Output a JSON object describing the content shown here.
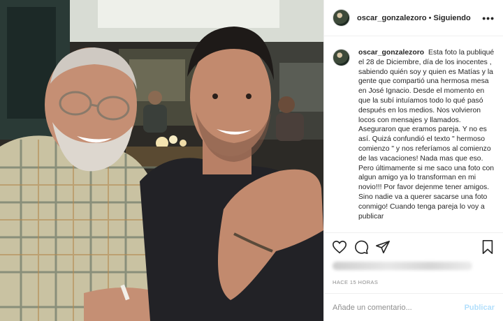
{
  "post": {
    "username": "oscar_gonzalezoro",
    "separator": "•",
    "follow_status": "Siguiendo",
    "more_icon": "more-options-icon",
    "caption_user": "oscar_gonzalezoro",
    "caption_text": "Esta foto la publiqué el 28 de Diciembre, día de los inocentes , sabiendo quién soy y quien es Matías y la gente que compartió una hermosa mesa en José Ignacio. Desde el momento en que la subí intuíamos todo lo qué pasó después en los medios. Nos volvieron locos con mensajes y llamados. Aseguraron que eramos pareja. Y no es así. Quizá confundió el texto \" hermoso comienzo \" y nos referíamos al comienzo de las vacaciones! Nada mas que eso. Pero últimamente si me saco una foto con algun amigo ya lo transforman en mi novio!!! Por favor dejenme tener amigos. Sino nadie va a querer sacarse una foto conmigo! Cuando tenga pareja lo voy a publicar",
    "timestamp": "HACE 15 HORAS",
    "icons": {
      "like": "heart-icon",
      "comment": "comment-icon",
      "share": "share-icon",
      "save": "bookmark-icon"
    }
  },
  "comment_box": {
    "placeholder": "Añade un comentario...",
    "post_label": "Publicar"
  },
  "colors": {
    "text": "#262626",
    "muted": "#8e8e8e",
    "border": "#efefef",
    "post_disabled": "#b2dffc"
  }
}
